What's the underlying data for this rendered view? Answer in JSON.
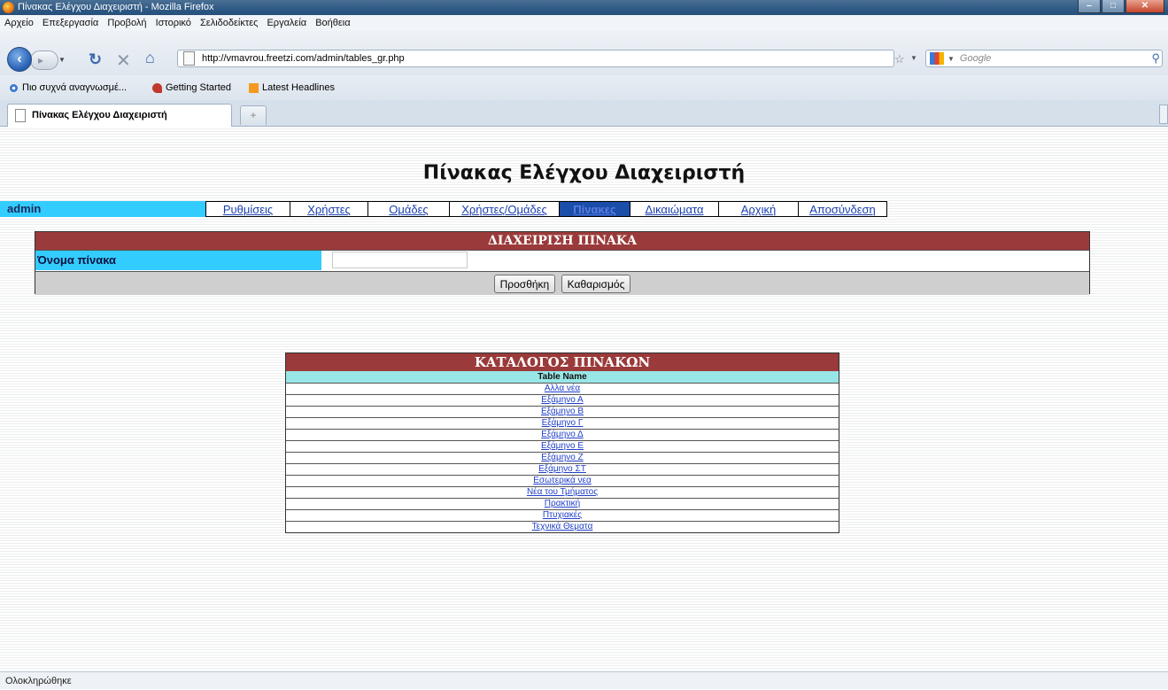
{
  "window": {
    "title": "Πίνακας Ελέγχου Διαχειριστή - Mozilla Firefox"
  },
  "menubar": [
    "Αρχείο",
    "Επεξεργασία",
    "Προβολή",
    "Ιστορικό",
    "Σελιδοδείκτες",
    "Εργαλεία",
    "Βοήθεια"
  ],
  "nav": {
    "url": "http://vmavrou.freetzi.com/admin/tables_gr.php",
    "search_placeholder": "Google"
  },
  "bookmarks": [
    "Πιο συχνά αναγνωσμέ...",
    "Getting Started",
    "Latest Headlines"
  ],
  "tabs": [
    {
      "label": "Πίνακας Ελέγχου Διαχειριστή"
    }
  ],
  "page": {
    "title": "Πίνακας Ελέγχου Διαχειριστή",
    "admin_label": "admin",
    "menu": [
      "Ρυθμίσεις",
      "Χρήστες",
      "Ομάδες",
      "Χρήστες/Ομάδες",
      "Πίνακες",
      "Δικαιώματα",
      "Αρχική",
      "Αποσύνδεση"
    ],
    "active_menu": "Πίνακες",
    "management": {
      "header": "ΔΙΑΧΕΙΡΙΣΗ ΠΙΝΑΚΑ",
      "field_label": "Όνομα πίνακα",
      "field_value": "",
      "add_button": "Προσθήκη",
      "clear_button": "Καθαρισμός"
    },
    "catalog": {
      "header": "ΚΑΤΑΛΟΓΟΣ ΠΙΝΑΚΩΝ",
      "column": "Table Name",
      "items": [
        "Αλλα νέα",
        "Εξάμηνο Α",
        "Εξάμηνο Β",
        "Εξάμηνο Γ",
        "Εξάμηνο Δ",
        "Εξάμηνο Ε",
        "Εξάμηνο Ζ",
        "Εξάμηνο ΣΤ",
        "Εσωτερικά νεα",
        "Νέα του Τμήματος",
        "Πρακτική",
        "Πτυχιακές",
        "Τεχνικά Θεματα"
      ]
    }
  },
  "statusbar": {
    "text": "Ολοκληρώθηκε"
  },
  "colors": {
    "header_red": "#9b3a3a",
    "cyan": "#33ccff",
    "col_head": "#99e6e6",
    "link": "#2040c8"
  }
}
